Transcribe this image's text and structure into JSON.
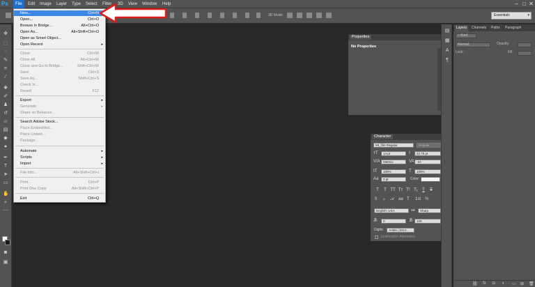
{
  "app": {
    "logo": "Ps"
  },
  "menubar": {
    "items": [
      "File",
      "Edit",
      "Image",
      "Layer",
      "Type",
      "Select",
      "Filter",
      "3D",
      "View",
      "Window",
      "Help"
    ],
    "window_controls": [
      "–",
      "□",
      "✕"
    ]
  },
  "options_bar": {
    "mode_label": "3D Mode:",
    "workspace": "Essentials"
  },
  "file_menu": {
    "items": [
      {
        "label": "New...",
        "shortcut": "Ctrl+N"
      },
      {
        "label": "Open...",
        "shortcut": "Ctrl+O"
      },
      {
        "label": "Browse in Bridge...",
        "shortcut": "Alt+Ctrl+O"
      },
      {
        "label": "Open As...",
        "shortcut": "Alt+Shift+Ctrl+O"
      },
      {
        "label": "Open as Smart Object...",
        "shortcut": ""
      },
      {
        "label": "Open Recent",
        "shortcut": ""
      },
      {
        "label": "Close",
        "shortcut": "Ctrl+W"
      },
      {
        "label": "Close All",
        "shortcut": "Alt+Ctrl+W"
      },
      {
        "label": "Close and Go to Bridge...",
        "shortcut": "Shift+Ctrl+W"
      },
      {
        "label": "Save",
        "shortcut": "Ctrl+S"
      },
      {
        "label": "Save As...",
        "shortcut": "Shift+Ctrl+S"
      },
      {
        "label": "Check In...",
        "shortcut": ""
      },
      {
        "label": "Revert",
        "shortcut": "F12"
      },
      {
        "label": "Export",
        "shortcut": ""
      },
      {
        "label": "Generate",
        "shortcut": ""
      },
      {
        "label": "Share on Behance...",
        "shortcut": ""
      },
      {
        "label": "Search Adobe Stock...",
        "shortcut": ""
      },
      {
        "label": "Place Embedded...",
        "shortcut": ""
      },
      {
        "label": "Place Linked...",
        "shortcut": ""
      },
      {
        "label": "Package...",
        "shortcut": ""
      },
      {
        "label": "Automate",
        "shortcut": ""
      },
      {
        "label": "Scripts",
        "shortcut": ""
      },
      {
        "label": "Import",
        "shortcut": ""
      },
      {
        "label": "File Info...",
        "shortcut": "Alt+Shift+Ctrl+I"
      },
      {
        "label": "Print...",
        "shortcut": "Ctrl+P"
      },
      {
        "label": "Print One Copy",
        "shortcut": "Alt+Shift+Ctrl+P"
      },
      {
        "label": "Exit",
        "shortcut": "Ctrl+Q"
      }
    ]
  },
  "properties_panel": {
    "tab": "Properties",
    "content": "No Properties"
  },
  "character_panel": {
    "tab": "Character",
    "font_family": "Mt_film Regular",
    "font_style": "Regular",
    "font_size": "14 pt",
    "leading": "22.75 pt",
    "kerning": "Metrics",
    "tracking": "-10",
    "vertical_scale": "100%",
    "horizontal_scale": "100%",
    "baseline_shift": "0 pt",
    "color_label": "Color:",
    "language": "English: USA",
    "aa_label": "aa",
    "anti_alias": "Sharp",
    "opentype_value_1": "0",
    "opentype_value_2": "100",
    "digits_label": "Digits:",
    "digits_value": "Arabic (3312...",
    "justification_label": "Justification Alternates",
    "style_buttons": [
      "T",
      "T",
      "TT",
      "Tт",
      "T¹",
      "T₁",
      "T",
      "T"
    ]
  },
  "layers_panel": {
    "tabs": [
      "Layers",
      "Channels",
      "Paths",
      "Paragraph"
    ],
    "filter": "Kind",
    "blend_mode": "Normal",
    "opacity_label": "Opacity:",
    "lock_label": "Lock:",
    "fill_label": "Fill:"
  }
}
